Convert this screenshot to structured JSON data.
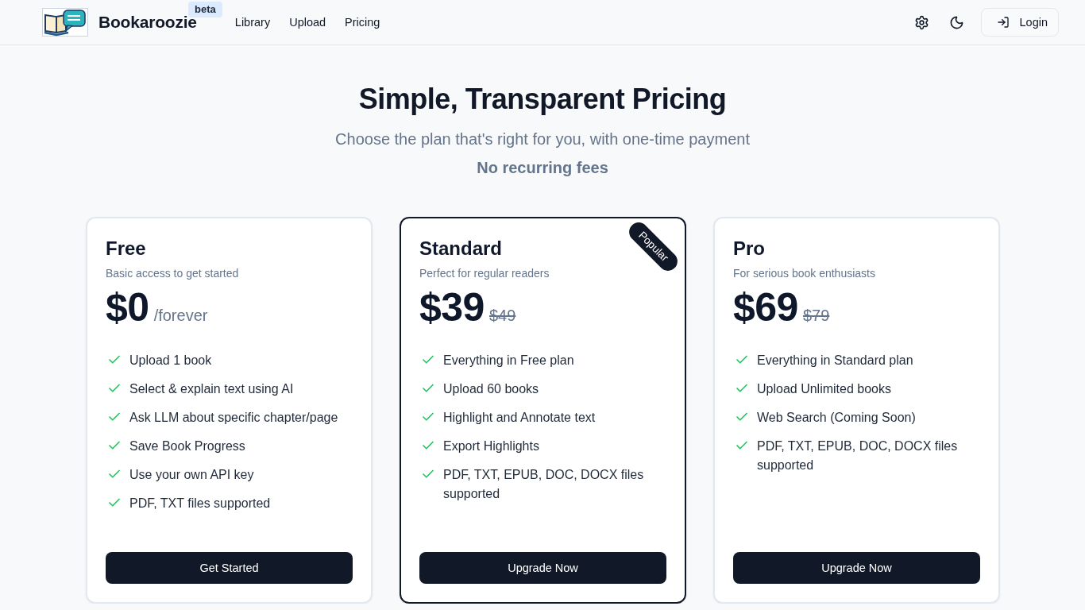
{
  "header": {
    "brand": "Bookaroozie",
    "badge": "beta",
    "nav": [
      "Library",
      "Upload",
      "Pricing"
    ],
    "login": "Login"
  },
  "hero": {
    "title": "Simple, Transparent Pricing",
    "subtitle": "Choose the plan that's right for you, with one-time payment",
    "note": "No recurring fees"
  },
  "plans": [
    {
      "name": "Free",
      "description": "Basic access to get started",
      "price": "$0",
      "period": "/forever",
      "featured": false,
      "features": [
        "Upload 1 book",
        "Select & explain text using AI",
        "Ask LLM about specific chapter/page",
        "Save Book Progress",
        "Use your own API key",
        "PDF, TXT files supported"
      ],
      "button": "Get Started"
    },
    {
      "name": "Standard",
      "description": "Perfect for regular readers",
      "price": "$39",
      "original_price": "$49",
      "badge": "Popular",
      "featured": true,
      "features": [
        "Everything in Free plan",
        "Upload 60 books",
        "Highlight and Annotate text",
        "Export Highlights",
        "PDF, TXT, EPUB, DOC, DOCX files supported"
      ],
      "button": "Upgrade Now"
    },
    {
      "name": "Pro",
      "description": "For serious book enthusiasts",
      "price": "$69",
      "original_price": "$79",
      "featured": false,
      "features": [
        "Everything in Standard plan",
        "Upload Unlimited books",
        "Web Search (Coming Soon)",
        "PDF, TXT, EPUB, DOC, DOCX files supported"
      ],
      "button": "Upgrade Now"
    }
  ]
}
